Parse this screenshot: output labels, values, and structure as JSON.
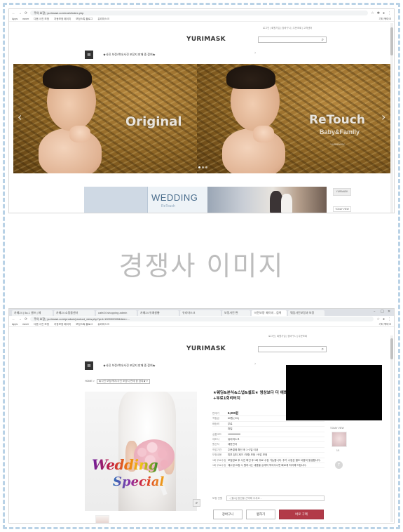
{
  "top_shot": {
    "address": "주의 요함 | yurimask.com/rush/index.php",
    "bookmarks": [
      "Apps",
      "naver",
      "다음 사진 보정",
      "자동보정 페이지",
      "보정스톡 블로그",
      "유리마스크"
    ],
    "other_bookmarks": "기타 북마크",
    "util_links": "로그인  |  회원가입  |  장바구니  |  주문조회  |  고객센터",
    "logo": "YURIMASK",
    "promo": "★사진 보정/액자/사진 포장지 판매 중 참여★",
    "slide_left_text": "Original",
    "slide_right_text": "ReTouch",
    "slide_right_sub": "Baby&Family",
    "slide_right_tag": "YURIMASK",
    "banner_title": "WEDDING",
    "banner_sub": "ReTouch",
    "side_chip_1": "YURIMASK",
    "side_chip_2": "TODAY VIEW"
  },
  "caption": "경쟁사 이미지",
  "bottom_shot": {
    "tabs": [
      "카페24 | 5a.1 셀프 | 페",
      "카페24 쇼핑몰센터",
      "cafe24 shopping admin",
      "카페24 유쾌살롱",
      "유리마스크",
      "보정사진 편",
      "'사진보정' 페이지 - 검색",
      "웨딩사진보정과 보정"
    ],
    "address": "주의 요함 | yurimask.com/product/product_view.php?prd=100000000&item=...",
    "bookmarks": [
      "Apps",
      "naver",
      "다음 사진 보정",
      "자동보정 페이지",
      "보정스톡 블로그",
      "유리마스크"
    ],
    "other_bookmarks": "기타 북마크",
    "util_links": "로그인  |  회원가입  |  장바구니  |  주문조회",
    "logo": "YURIMASK",
    "promo": "★사진 보정/액자/사진 포장지 판매 중 참여★",
    "breadcrumb_prefix": "HOME >",
    "breadcrumb_select": "★사진 보정/액자/사진 포장지 판매 중 참여★ ▾",
    "image_text_1": "Wedding",
    "image_text_2": "Special",
    "product_title": "★웨딩&본식&스냅&셀프★ 영상보다 더 예쁘게 보정! +무료1회리터치",
    "info_rows": [
      {
        "k": "판매가",
        "v": "6,000원"
      },
      {
        "k": "적립금",
        "v": "60원 (1%)"
      },
      {
        "k": "배송비",
        "v": "무료"
      },
      {
        "k": "",
        "v": "파일"
      },
      {
        "k": "상품코드",
        "v": "100000000"
      },
      {
        "k": "제조사",
        "v": "유리마스크"
      },
      {
        "k": "원산지",
        "v": "대한민국"
      },
      {
        "k": "작업기간",
        "v": "주문결제 확인 후 1~3일 이내"
      },
      {
        "k": "보정내용",
        "v": "피부 잡티 제거 / 체형 보정 / 색감 보정"
      },
      {
        "k": "1회 무료수정",
        "v": "보정완료 후 사진 확인 후 1회 무료 수정 가능합니다. 추가 수정은 별도 비용이 발생합니다."
      },
      {
        "k": "1회 무료수정",
        "v": "재수정 요청 시 원하시는 내용을 상세히 적어주시면 빠르게 처리해 드립니다."
      }
    ],
    "option_label": "보정 인원",
    "option_placeholder": "- [필수] 옵션을 선택해 주세요 -",
    "btn_cart": "장바구니",
    "btn_wish": "찜하기",
    "btn_buy": "바로 구매",
    "side_title": "TODAY VIEW",
    "side_sub": "1/1"
  }
}
